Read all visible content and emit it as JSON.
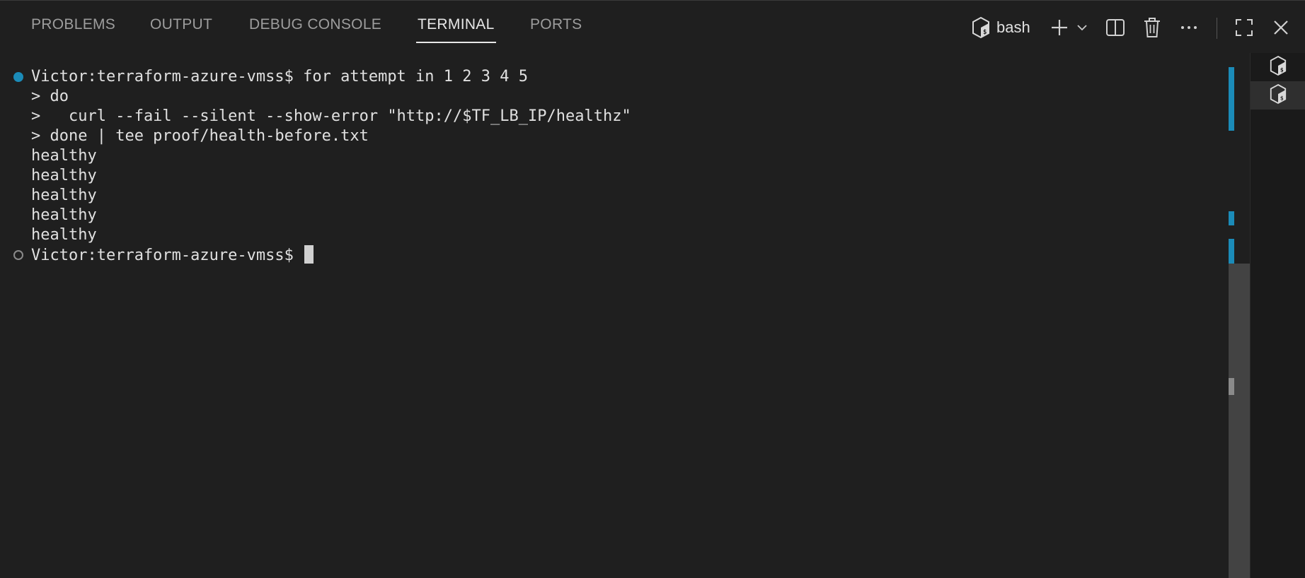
{
  "panel": {
    "tabs": [
      {
        "label": "PROBLEMS"
      },
      {
        "label": "OUTPUT"
      },
      {
        "label": "DEBUG CONSOLE"
      },
      {
        "label": "TERMINAL",
        "active": true
      },
      {
        "label": "PORTS"
      }
    ],
    "toolbar": {
      "shell_name": "bash",
      "icons": [
        "terminal-shell-icon",
        "plus-icon",
        "chevron-down-icon",
        "split-icon",
        "trash-icon",
        "more-icon",
        "maximize-icon",
        "close-icon"
      ]
    }
  },
  "terminal": {
    "lines": [
      "Victor:terraform-azure-vmss$ for attempt in 1 2 3 4 5",
      "> do",
      ">   curl --fail --silent --show-error \"http://$TF_LB_IP/healthz\"",
      "> done | tee proof/health-before.txt",
      "healthy",
      "healthy",
      "healthy",
      "healthy",
      "healthy",
      "Victor:terraform-azure-vmss$ "
    ],
    "markers": {
      "first_command": "success",
      "current_prompt": "pending"
    }
  },
  "colors": {
    "background": "#1f1f1f",
    "accent": "#1b8bb8",
    "text": "#e0e0e0",
    "inactive_tab": "#9d9d9d"
  },
  "terminal_list": {
    "entries": [
      "bash-terminal-icon",
      "bash-terminal-icon"
    ],
    "selected_index": 1
  }
}
